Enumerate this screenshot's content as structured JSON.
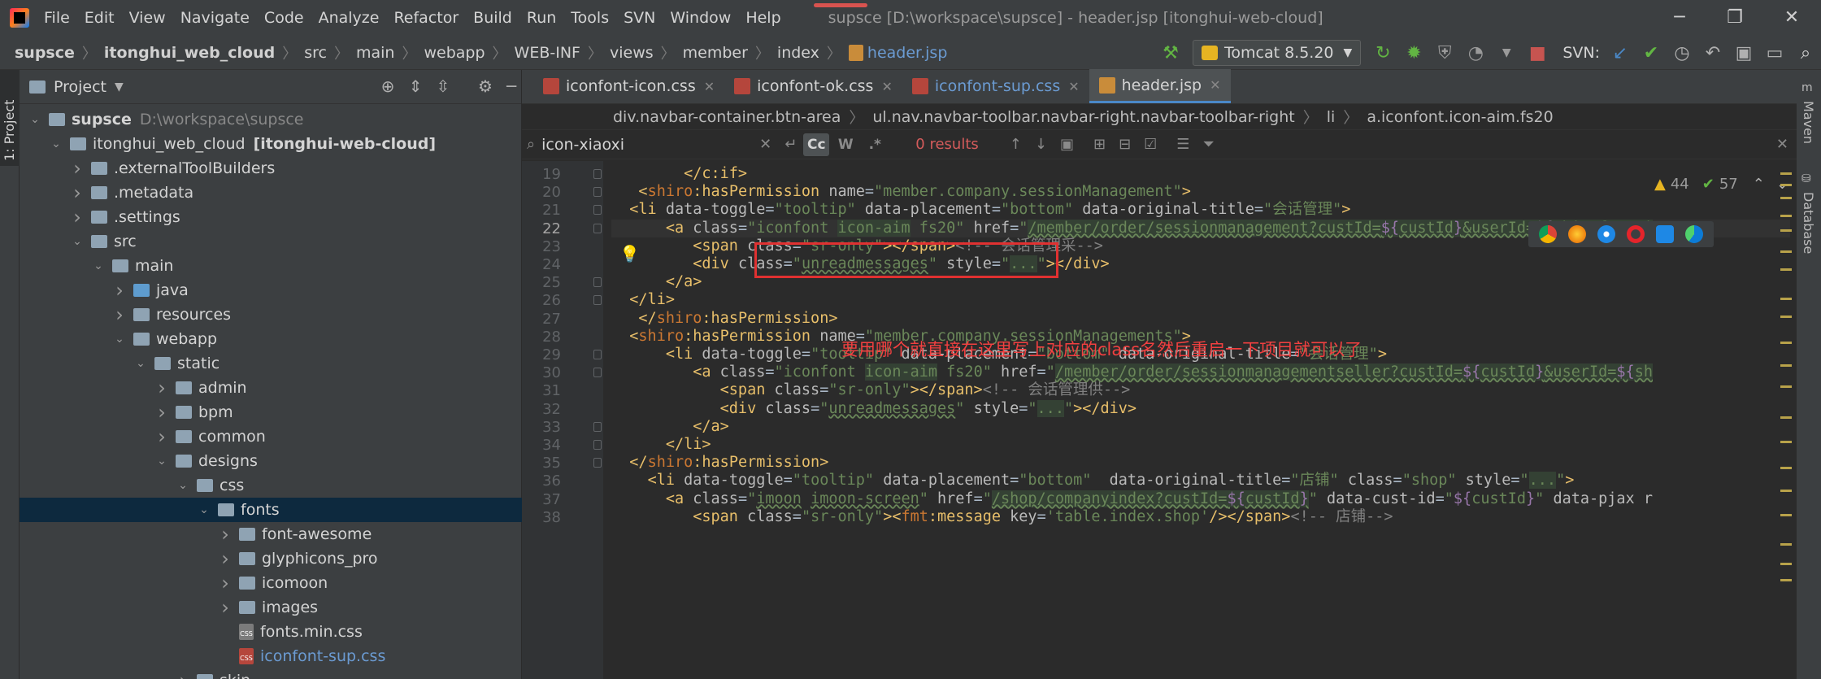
{
  "menu": [
    "File",
    "Edit",
    "View",
    "Navigate",
    "Code",
    "Analyze",
    "Refactor",
    "Build",
    "Run",
    "Tools",
    "SVN",
    "Window",
    "Help"
  ],
  "window_title": "supsce [D:\\workspace\\supsce] - header.jsp [itonghui-web-cloud]",
  "breadcrumb": [
    "supsce",
    "itonghui_web_cloud",
    "src",
    "main",
    "webapp",
    "WEB-INF",
    "views",
    "member",
    "index",
    "header.jsp"
  ],
  "run_config": "Tomcat 8.5.20",
  "svn_label": "SVN:",
  "project_panel": {
    "title": "Project",
    "tree": [
      {
        "depth": 0,
        "arrow": "down",
        "icon": "module",
        "label": "supsce",
        "extra": "D:\\workspace\\supsce",
        "bold": true
      },
      {
        "depth": 1,
        "arrow": "down",
        "icon": "module",
        "label": "itonghui_web_cloud",
        "extra": "[itonghui-web-cloud]",
        "bold": false
      },
      {
        "depth": 2,
        "arrow": "right",
        "icon": "folder",
        "label": ".externalToolBuilders"
      },
      {
        "depth": 2,
        "arrow": "right",
        "icon": "folder",
        "label": ".metadata"
      },
      {
        "depth": 2,
        "arrow": "right",
        "icon": "folder",
        "label": ".settings"
      },
      {
        "depth": 2,
        "arrow": "down",
        "icon": "folder",
        "label": "src"
      },
      {
        "depth": 3,
        "arrow": "down",
        "icon": "folder",
        "label": "main"
      },
      {
        "depth": 4,
        "arrow": "right",
        "icon": "folder-blue",
        "label": "java"
      },
      {
        "depth": 4,
        "arrow": "right",
        "icon": "folder",
        "label": "resources"
      },
      {
        "depth": 4,
        "arrow": "down",
        "icon": "folder",
        "label": "webapp"
      },
      {
        "depth": 5,
        "arrow": "down",
        "icon": "folder",
        "label": "static"
      },
      {
        "depth": 6,
        "arrow": "right",
        "icon": "folder",
        "label": "admin"
      },
      {
        "depth": 6,
        "arrow": "right",
        "icon": "folder",
        "label": "bpm"
      },
      {
        "depth": 6,
        "arrow": "right",
        "icon": "folder",
        "label": "common"
      },
      {
        "depth": 6,
        "arrow": "down",
        "icon": "folder",
        "label": "designs"
      },
      {
        "depth": 7,
        "arrow": "down",
        "icon": "folder",
        "label": "css"
      },
      {
        "depth": 8,
        "arrow": "down",
        "icon": "folder",
        "label": "fonts",
        "selected": true
      },
      {
        "depth": 9,
        "arrow": "right",
        "icon": "folder",
        "label": "font-awesome"
      },
      {
        "depth": 9,
        "arrow": "right",
        "icon": "folder",
        "label": "glyphicons_pro"
      },
      {
        "depth": 9,
        "arrow": "right",
        "icon": "folder",
        "label": "icomoon"
      },
      {
        "depth": 9,
        "arrow": "right",
        "icon": "folder",
        "label": "images"
      },
      {
        "depth": 9,
        "arrow": "none",
        "icon": "css",
        "label": "fonts.min.css"
      },
      {
        "depth": 9,
        "arrow": "none",
        "icon": "css-red",
        "label": "iconfont-sup.css",
        "link": true
      },
      {
        "depth": 7,
        "arrow": "right",
        "icon": "folder",
        "label": "skin"
      }
    ]
  },
  "left_strip_label": "1: Project",
  "tabs": [
    {
      "label": "iconfont-icon.css",
      "type": "css"
    },
    {
      "label": "iconfont-ok.css",
      "type": "css"
    },
    {
      "label": "iconfont-sup.css",
      "type": "css",
      "link": true
    },
    {
      "label": "header.jsp",
      "type": "jsp",
      "active": true
    }
  ],
  "editor_breadcrumb": [
    "div.navbar-container.btn-area",
    "ul.nav.navbar-toolbar.navbar-right.navbar-toolbar-right",
    "li",
    "a.iconfont.icon-aim.fs20"
  ],
  "search": {
    "value": "icon-xiaoxi",
    "results": "0 results",
    "cc": "Cc",
    "w": "W",
    "regex": ".*"
  },
  "inspection": {
    "warnings": "44",
    "ok": "57"
  },
  "line_numbers": [
    "19",
    "20",
    "21",
    "22",
    "23",
    "24",
    "25",
    "26",
    "27",
    "28",
    "29",
    "30",
    "31",
    "32",
    "33",
    "34",
    "35",
    "36",
    "37",
    "38"
  ],
  "current_line": "22",
  "annotation": "要用哪个就直接在这里写上对应的class名然后重启一下项目就可以了",
  "right_strip": [
    "Maven",
    "Database"
  ]
}
